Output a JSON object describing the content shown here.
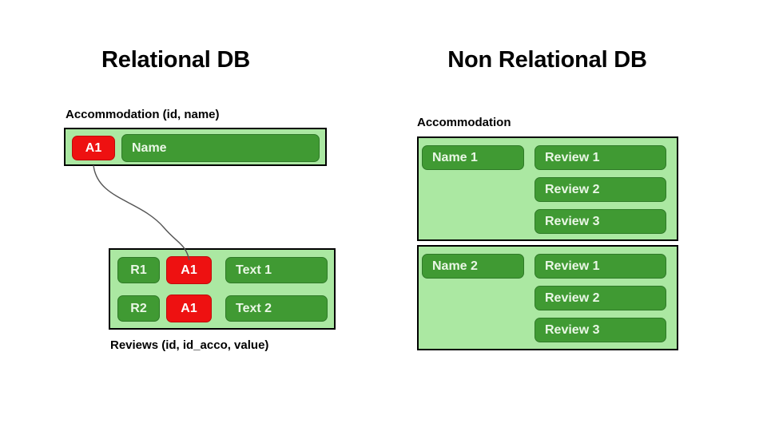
{
  "colors": {
    "box_fill": "#ABE8A2",
    "pill_fill": "#409A33",
    "key_fill": "#EE1111",
    "box_border": "#000000",
    "text_light": "#EAF7E6",
    "connector": "#555555"
  },
  "left_panel": {
    "title": "Relational DB",
    "accommodation": {
      "caption": "Accommodation (id, name)",
      "cells": [
        {
          "label": "A1",
          "type": "key"
        },
        {
          "label": "Name",
          "type": "value"
        }
      ]
    },
    "reviews": {
      "caption": "Reviews (id, id_acco, value)",
      "rows": [
        [
          {
            "label": "R1",
            "type": "value"
          },
          {
            "label": "A1",
            "type": "key"
          },
          {
            "label": "Text 1",
            "type": "value"
          }
        ],
        [
          {
            "label": "R2",
            "type": "value"
          },
          {
            "label": "A1",
            "type": "key"
          },
          {
            "label": "Text 2",
            "type": "value"
          }
        ]
      ]
    }
  },
  "right_panel": {
    "title": "Non Relational DB",
    "collection_caption": "Accommodation",
    "documents": [
      {
        "name": "Name 1",
        "reviews": [
          "Review 1",
          "Review 2",
          "Review 3"
        ]
      },
      {
        "name": "Name 2",
        "reviews": [
          "Review 1",
          "Review 2",
          "Review 3"
        ]
      }
    ]
  }
}
